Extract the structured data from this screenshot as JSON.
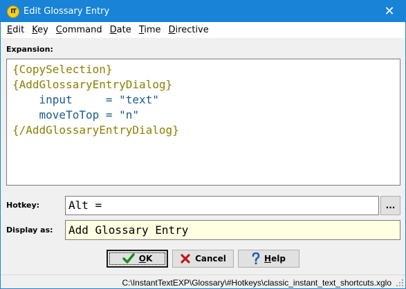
{
  "window": {
    "title": "Edit Glossary Entry",
    "app_icon_text": "IT",
    "close_glyph": "✕"
  },
  "menu": [
    {
      "mnemonic": "E",
      "rest": "dit"
    },
    {
      "mnemonic": "K",
      "rest": "ey"
    },
    {
      "mnemonic": "C",
      "rest": "ommand"
    },
    {
      "mnemonic": "D",
      "rest": "ate"
    },
    {
      "mnemonic": "T",
      "rest": "ime"
    },
    {
      "mnemonic": "D",
      "rest": "irective"
    }
  ],
  "expansion": {
    "label": "Expansion:",
    "lines": {
      "l1": "{CopySelection}",
      "l2": "{AddGlossaryEntryDialog}",
      "l3_key": "    input     ",
      "l3_val": "= \"text\"",
      "l4_key": "    moveToTop ",
      "l4_val": "= \"n\"",
      "l5": "{/AddGlossaryEntryDialog}"
    }
  },
  "hotkey": {
    "label": "Hotkey:",
    "value": "Alt =",
    "browse_label": "..."
  },
  "display_as": {
    "label": "Display as:",
    "value": "Add Glossary Entry"
  },
  "buttons": {
    "ok": {
      "mnemonic": "O",
      "rest": "K"
    },
    "cancel": {
      "label": "Cancel"
    },
    "help": {
      "mnemonic": "H",
      "rest": "elp"
    }
  },
  "status": {
    "path": "C:\\InstantTextEXP\\Glossary\\#Hotkeys\\classic_instant_text_shortcuts.xglo"
  },
  "colors": {
    "titlebar": "#1883d7",
    "tag": "#8b8000",
    "param": "#1b5a8a",
    "display_bg": "#ffffe1"
  },
  "icons": {
    "app": "instanttext-logo-icon",
    "close": "close-icon",
    "ok": "checkmark-icon",
    "cancel": "cancel-x-icon",
    "help": "question-mark-icon",
    "grip": "resize-grip-icon"
  }
}
